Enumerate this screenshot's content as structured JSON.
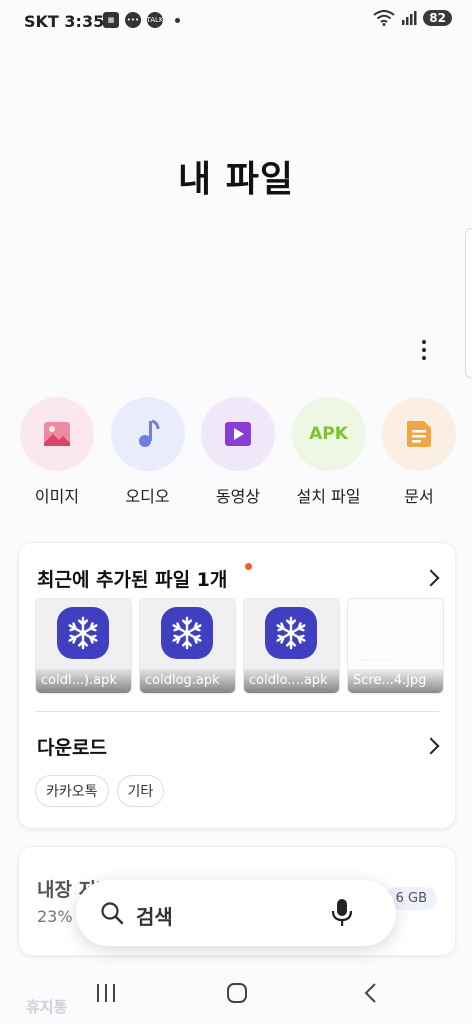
{
  "status_bar": {
    "carrier": "SKT",
    "time": "3:35",
    "battery": "82",
    "wifi_superscript": "6"
  },
  "page": {
    "title": "내 파일"
  },
  "categories": [
    {
      "label": "이미지",
      "icon": "image-icon",
      "bg": "#fbe8ef",
      "color": "#e8577a"
    },
    {
      "label": "오디오",
      "icon": "music-note-icon",
      "bg": "#e9ecfb",
      "color": "#6f7fe0"
    },
    {
      "label": "동영상",
      "icon": "video-play-icon",
      "bg": "#f0e8f9",
      "color": "#8a3dd6"
    },
    {
      "label": "설치 파일",
      "icon": "apk-icon",
      "icon_text": "APK",
      "bg": "#eef7e3",
      "color": "#7bc42b"
    },
    {
      "label": "문서",
      "icon": "document-icon",
      "bg": "#fbefe3",
      "color": "#f2a545"
    }
  ],
  "recent": {
    "title": "최근에 추가된 파일 1개",
    "files": [
      {
        "name": "coldl...).apk"
      },
      {
        "name": "coldlog.apk"
      },
      {
        "name": "coldlo....apk"
      },
      {
        "name": "Scre...4.jpg"
      }
    ]
  },
  "downloads": {
    "title": "다운로드",
    "chips": [
      "카카오톡",
      "기타"
    ]
  },
  "storage": {
    "title": "내장 저장공간",
    "percent": "23%",
    "size_text": "6 GB"
  },
  "search": {
    "placeholder": "검색"
  },
  "bottom_ghost_text": "휴지통"
}
